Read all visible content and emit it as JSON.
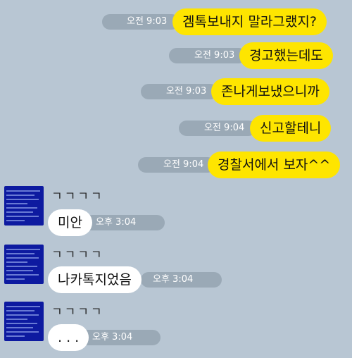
{
  "sent_messages": [
    {
      "text": "겜톡보내지 말라그랬지?",
      "time": "오전 9:03"
    },
    {
      "text": "경고했는데도",
      "time": "오전 9:03"
    },
    {
      "text": "존나게보냈으니까",
      "time": "오전 9:03"
    },
    {
      "text": "신고할테니",
      "time": "오전 9:04"
    },
    {
      "text": "경찰서에서 보자^^",
      "time": "오전 9:04"
    }
  ],
  "received_messages": [
    {
      "sender": "ㄱㄱㄱㄱ",
      "text": "미안",
      "time": "오후 3:04"
    },
    {
      "sender": "ㄱㄱㄱㄱ",
      "text": "나카톡지었음",
      "time": "오후 3:04"
    },
    {
      "sender": "ㄱㄱㄱㄱ",
      "text": ". . .",
      "time": "오후 3:04"
    }
  ],
  "colors": {
    "background": "#b8c6d3",
    "sent_bubble": "#fee500",
    "received_bubble": "#ffffff",
    "time_pill": "#9aa9b6",
    "avatar": "#0d1aa0"
  }
}
